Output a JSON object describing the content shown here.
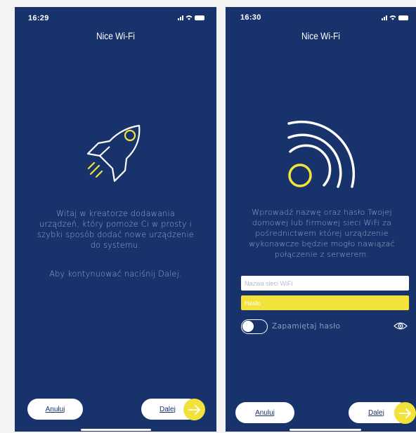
{
  "left_screen": {
    "status_time": "16:29",
    "title": "Nice Wi-Fi",
    "illustration_icon": "rocket-icon",
    "description_lines": [
      "Witaj w kreatorze dodawania",
      "urządzeń, który pomoże Ci w prosty i",
      "szybki sposób dodać nowe urządzenie",
      "do systemu."
    ],
    "hint": "Aby kontynuować naciśnij Dalej.",
    "cancel_label": "Anuluj",
    "next_label": "Dalej",
    "next_icon": "arrow-right-icon"
  },
  "right_screen": {
    "status_time": "16:30",
    "title": "Nice Wi-Fi",
    "illustration_icon": "wifi-signal-icon",
    "description_lines": [
      "Wprowadź nazwę oraz hasło Twojej",
      "domowej lub firmowej sieci WiFi za",
      "pośrednictwem której urządzenie",
      "wykonawcze będzie mogło nawiązać",
      "połączenie z serwerem."
    ],
    "ssid_placeholder": "Nazwa sieci WiFi",
    "password_placeholder": "Hasło",
    "remember_label": "Zapamiętaj hasło",
    "remember_on": false,
    "show_password_icon": "eye-icon",
    "cancel_label": "Anuluj",
    "next_label": "Dalej",
    "next_icon": "arrow-right-icon"
  },
  "colors": {
    "background": "#18336b",
    "accent": "#f3e23a",
    "text": "#ffffff",
    "muted_text": "#9aa6c6"
  }
}
